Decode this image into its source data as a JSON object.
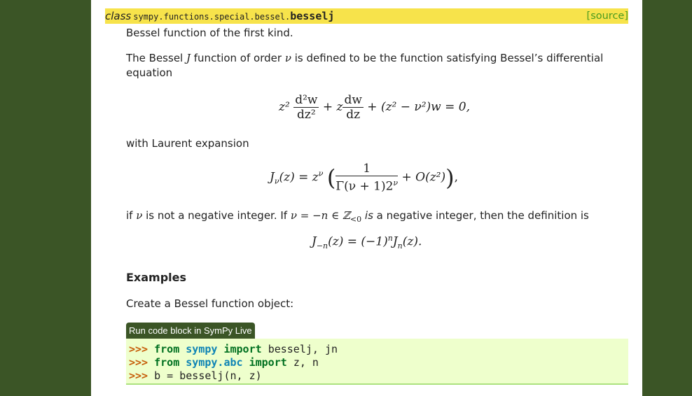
{
  "signature": {
    "keyword": "class",
    "module": "sympy.functions.special.bessel.",
    "name": "besselj",
    "source_link": "[source]"
  },
  "summary": "Bessel function of the first kind.",
  "intro": {
    "part1": "The Bessel ",
    "J": "J",
    "part2": " function of order ",
    "nu": "ν",
    "part3": " is defined to be the function satisfying Bessel’s differential",
    "line2": "equation"
  },
  "equation1": {
    "z2": "z²",
    "frac1_num": "d²w",
    "frac1_den": "dz²",
    "plus_z": "+ z",
    "frac2_num": "dw",
    "frac2_den": "dz",
    "rest": "+ (z² − ν²)w = 0,"
  },
  "laurent_text": "with Laurent expansion",
  "equation2": {
    "lhs": "J",
    "lhs_sub": "ν",
    "lhs_rest": "(z) = z",
    "lhs_sup": "ν",
    "frac_num": "1",
    "frac_den": "Γ(ν + 1)2",
    "frac_den_sup": "ν",
    "rest": "+ O(z²)",
    "trail": ","
  },
  "condition": {
    "p1": "if ",
    "nu": "ν",
    "p2": " is not a negative integer. If ",
    "expr": "ν = −n ∈ ℤ",
    "expr_sub": "<0",
    "p3": " is",
    "p4": " a negative integer, then the definition is"
  },
  "equation3": {
    "J": "J",
    "sub": "−n",
    "mid": "(z) = (−1)",
    "sup": "n",
    "J2": "J",
    "sub2": "n",
    "end": "(z)."
  },
  "examples_heading": "Examples",
  "examples_intro": "Create a Bessel function object:",
  "run_button": "Run code block in SymPy Live",
  "code_lines": [
    {
      "prompt": ">>>",
      "kw1": "from",
      "mod": "sympy",
      "kw2": "import",
      "rest": "besselj, jn"
    },
    {
      "prompt": ">>>",
      "kw1": "from",
      "mod": "sympy.abc",
      "kw2": "import",
      "rest": "z, n"
    },
    {
      "prompt": ">>>",
      "rest": "b = besselj(n, z)"
    }
  ],
  "colors": {
    "background": "#3b5526",
    "signature_bg": "#f7e34b",
    "source_link": "#4a9b1f",
    "code_bg": "#eeffcc",
    "prompt": "#c65d09",
    "keyword": "#007020",
    "module": "#0e84b5"
  }
}
